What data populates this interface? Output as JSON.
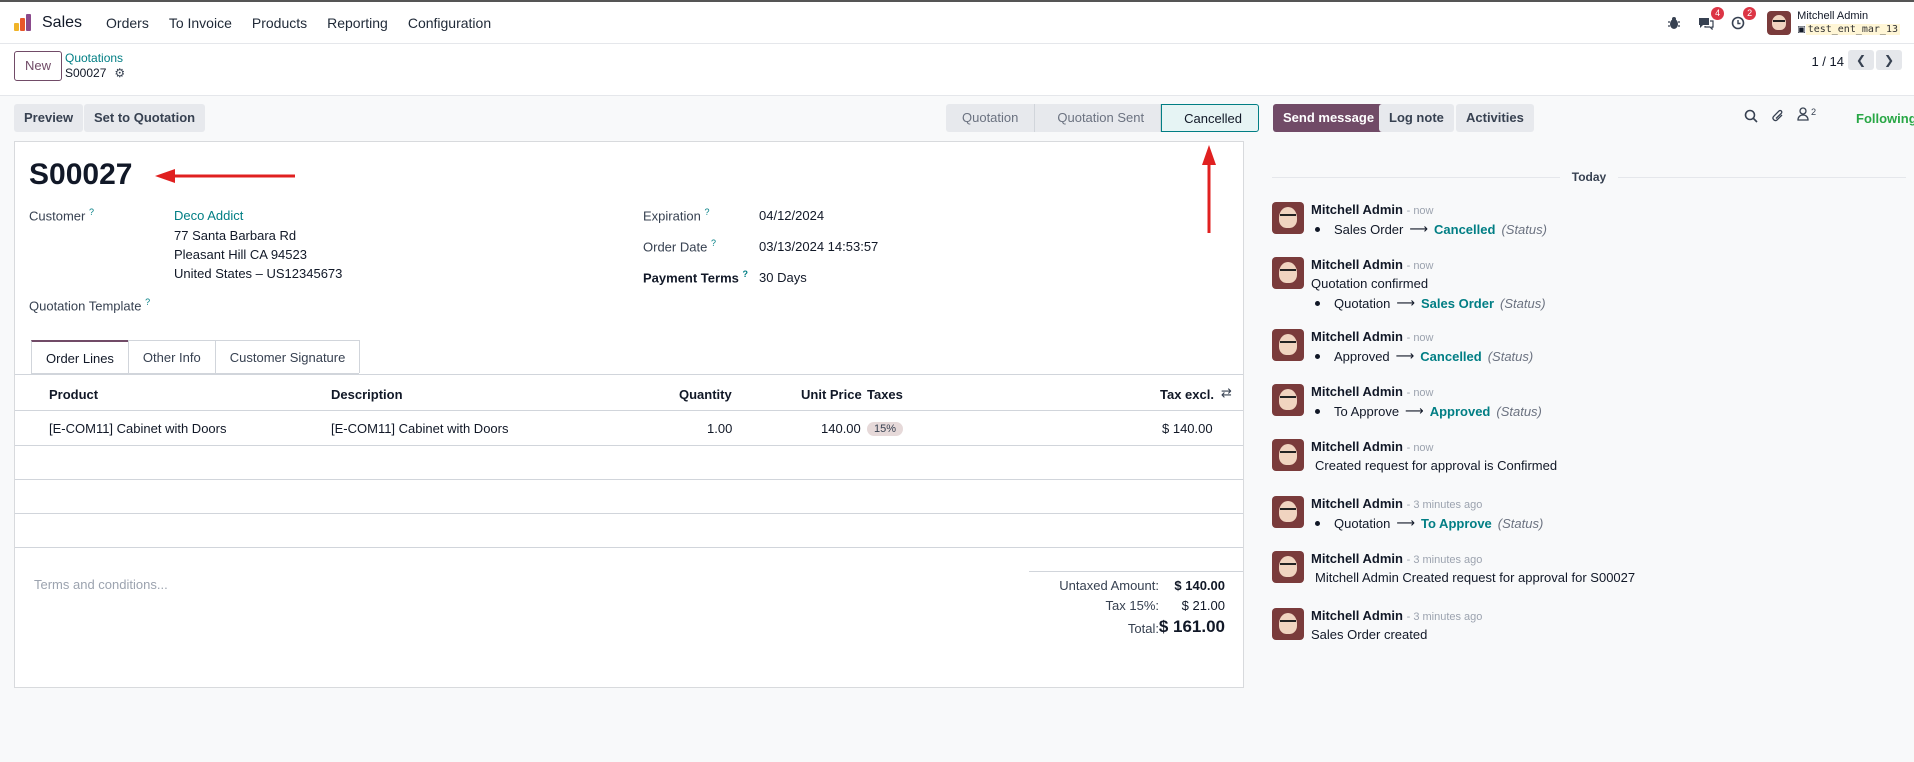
{
  "topbar": {
    "app_name": "Sales",
    "menu": [
      "Orders",
      "To Invoice",
      "Products",
      "Reporting",
      "Configuration"
    ],
    "messages_count": "4",
    "activities_count": "2",
    "user_name": "Mitchell Admin",
    "db_name": "test_ent_mar_13"
  },
  "control": {
    "new_label": "New",
    "breadcrumb_parent": "Quotations",
    "breadcrumb_current": "S00027",
    "pager": "1 / 14"
  },
  "actions": {
    "preview": "Preview",
    "set_to_quotation": "Set to Quotation"
  },
  "statusbar": {
    "stages": [
      "Quotation",
      "Quotation Sent",
      "Cancelled"
    ],
    "active": "Cancelled"
  },
  "form": {
    "title": "S00027",
    "customer_label": "Customer",
    "customer_name": "Deco Addict",
    "address_line1": "77 Santa Barbara Rd",
    "address_line2": "Pleasant Hill CA 94523",
    "address_line3": "United States – US12345673",
    "template_label": "Quotation Template",
    "expiration_label": "Expiration",
    "expiration_value": "04/12/2024",
    "order_date_label": "Order Date",
    "order_date_value": "03/13/2024 14:53:57",
    "payment_terms_label": "Payment Terms",
    "payment_terms_value": "30 Days"
  },
  "tabs": [
    "Order Lines",
    "Other Info",
    "Customer Signature"
  ],
  "table": {
    "headers": [
      "Product",
      "Description",
      "Quantity",
      "Unit Price",
      "Taxes",
      "Tax excl."
    ],
    "rows": [
      {
        "product": "[E-COM11] Cabinet with Doors",
        "description": "[E-COM11] Cabinet with Doors",
        "quantity": "1.00",
        "unit_price": "140.00",
        "taxes": "15%",
        "subtotal": "$ 140.00"
      }
    ]
  },
  "terms_placeholder": "Terms and conditions...",
  "totals": {
    "untaxed_label": "Untaxed Amount:",
    "untaxed_value": "$ 140.00",
    "tax_label": "Tax 15%:",
    "tax_value": "$ 21.00",
    "total_label": "Total:",
    "total_value": "$ 161.00"
  },
  "chatter": {
    "send_message": "Send message",
    "log_note": "Log note",
    "activities": "Activities",
    "followers_count": "2",
    "following": "Following",
    "today": "Today",
    "messages": [
      {
        "author": "Mitchell Admin",
        "time": "- now",
        "text": "",
        "old": "Sales Order",
        "new": "Cancelled",
        "field": "(Status)"
      },
      {
        "author": "Mitchell Admin",
        "time": "- now",
        "text": "Quotation confirmed",
        "old": "Quotation",
        "new": "Sales Order",
        "field": "(Status)"
      },
      {
        "author": "Mitchell Admin",
        "time": "- now",
        "text": "",
        "old": "Approved",
        "new": "Cancelled",
        "field": "(Status)"
      },
      {
        "author": "Mitchell Admin",
        "time": "- now",
        "text": "",
        "old": "To Approve",
        "new": "Approved",
        "field": "(Status)"
      },
      {
        "author": "Mitchell Admin",
        "time": "- now",
        "text": "Created request for approval is Confirmed",
        "old": "",
        "new": "",
        "field": ""
      },
      {
        "author": "Mitchell Admin",
        "time": "- 3 minutes ago",
        "text": "",
        "old": "Quotation",
        "new": "To Approve",
        "field": "(Status)"
      },
      {
        "author": "Mitchell Admin",
        "time": "- 3 minutes ago",
        "text": "Mitchell Admin Created request for approval for S00027",
        "old": "",
        "new": "",
        "field": ""
      },
      {
        "author": "Mitchell Admin",
        "time": "- 3 minutes ago",
        "text": "Sales Order created",
        "old": "",
        "new": "",
        "field": ""
      }
    ]
  }
}
